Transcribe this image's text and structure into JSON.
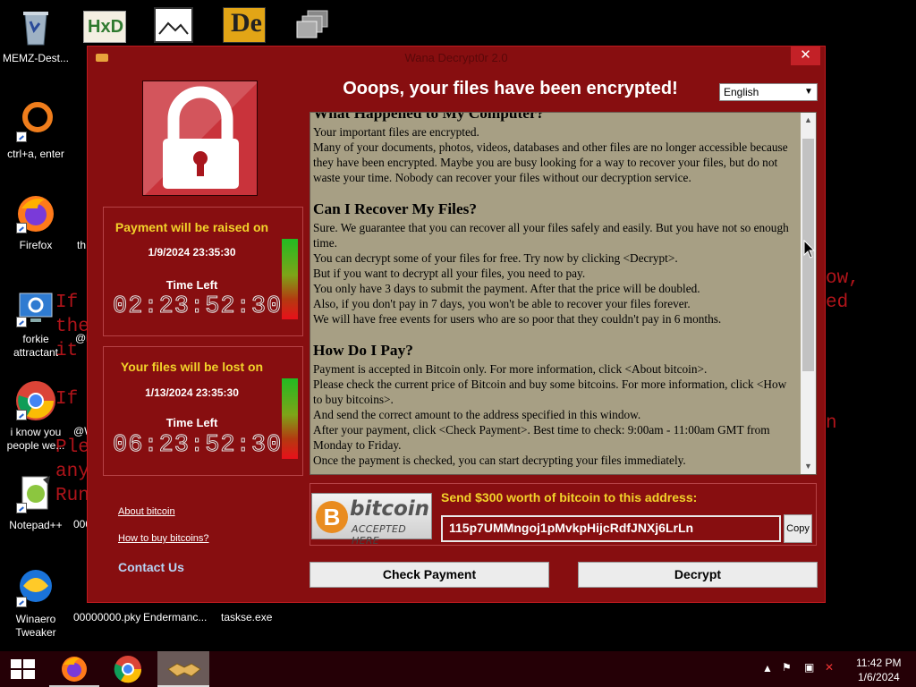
{
  "desktop": {
    "icons": [
      {
        "label": "MEMZ-Dest..."
      },
      {
        "label": "ctrl+a, enter"
      },
      {
        "label": "Firefox"
      },
      {
        "label": "forkie attractant"
      },
      {
        "label": "i know you people we..."
      },
      {
        "label": "Notepad++"
      },
      {
        "label": "Winaero Tweaker"
      },
      {
        "label": "00000000.pky"
      },
      {
        "label": "Endermanc..."
      },
      {
        "label": "taskse.exe"
      }
    ],
    "partial_labels": [
      "th",
      "@l",
      "@W",
      "000"
    ],
    "background_lines": [
      "If",
      "the",
      "it",
      "If",
      "Ple",
      "any",
      "Run",
      "ow,",
      "ed",
      "n"
    ]
  },
  "window": {
    "title": "Wana Decrypt0r 2.0",
    "close_label": "✕",
    "heading": "Ooops, your files have been encrypted!",
    "language": "English",
    "raise_panel": {
      "title": "Payment will be raised on",
      "date": "1/9/2024 23:35:30",
      "time_left_label": "Time Left",
      "countdown": "02:23:52:30",
      "bar_level": 0.75
    },
    "lost_panel": {
      "title": "Your files will be lost on",
      "date": "1/13/2024 23:35:30",
      "time_left_label": "Time Left",
      "countdown": "06:23:52:30",
      "bar_level": 0.75
    },
    "links": {
      "about_bitcoin": "About bitcoin",
      "how_to_buy": "How to buy bitcoins?",
      "contact": "Contact Us"
    },
    "text": {
      "clipped_heading": "What Happened to My Computer?",
      "p1": [
        "Your important files are encrypted.",
        "Many of your documents, photos, videos, databases and other files are no longer accessible because they have been encrypted. Maybe you are busy looking for a way to recover your files, but do not waste your time. Nobody can recover your files without our decryption service."
      ],
      "h2": "Can I Recover My Files?",
      "p2": [
        "Sure. We guarantee that you can recover all your files safely and easily. But you have not so enough time.",
        "You can decrypt some of your files for free. Try now by clicking <Decrypt>.",
        "But if you want to decrypt all your files, you need to pay.",
        "You only have 3 days to submit the payment. After that the price will be doubled.",
        "Also, if you don't pay in 7 days, you won't be able to recover your files forever.",
        "We will have free events for users who are so poor that they couldn't pay in 6 months."
      ],
      "h3": "How Do I Pay?",
      "p3": [
        "Payment is accepted in Bitcoin only. For more information, click <About bitcoin>.",
        "Please check the current price of Bitcoin and buy some bitcoins. For more information, click <How to buy bitcoins>.",
        "And send the correct amount to the address specified in this window.",
        "After your payment, click <Check Payment>. Best time to check: 9:00am - 11:00am GMT from Monday to Friday.",
        "Once the payment is checked, you can start decrypting your files immediately."
      ]
    },
    "bitcoin": {
      "logo_word": "bitcoin",
      "logo_accepted": "ACCEPTED HERE",
      "send_label": "Send $300 worth of bitcoin to this address:",
      "address": "115p7UMMngoj1pMvkpHijcRdfJNXj6LrLn",
      "copy_label": "Copy"
    },
    "buttons": {
      "check_payment": "Check Payment",
      "decrypt": "Decrypt"
    }
  },
  "taskbar": {
    "time": "11:42 PM",
    "date": "1/6/2024"
  },
  "colors": {
    "window_bg": "#870e10",
    "accent_yellow": "#f2d22a",
    "text_area_bg": "#a79f84",
    "taskbar_bg": "#250006"
  }
}
